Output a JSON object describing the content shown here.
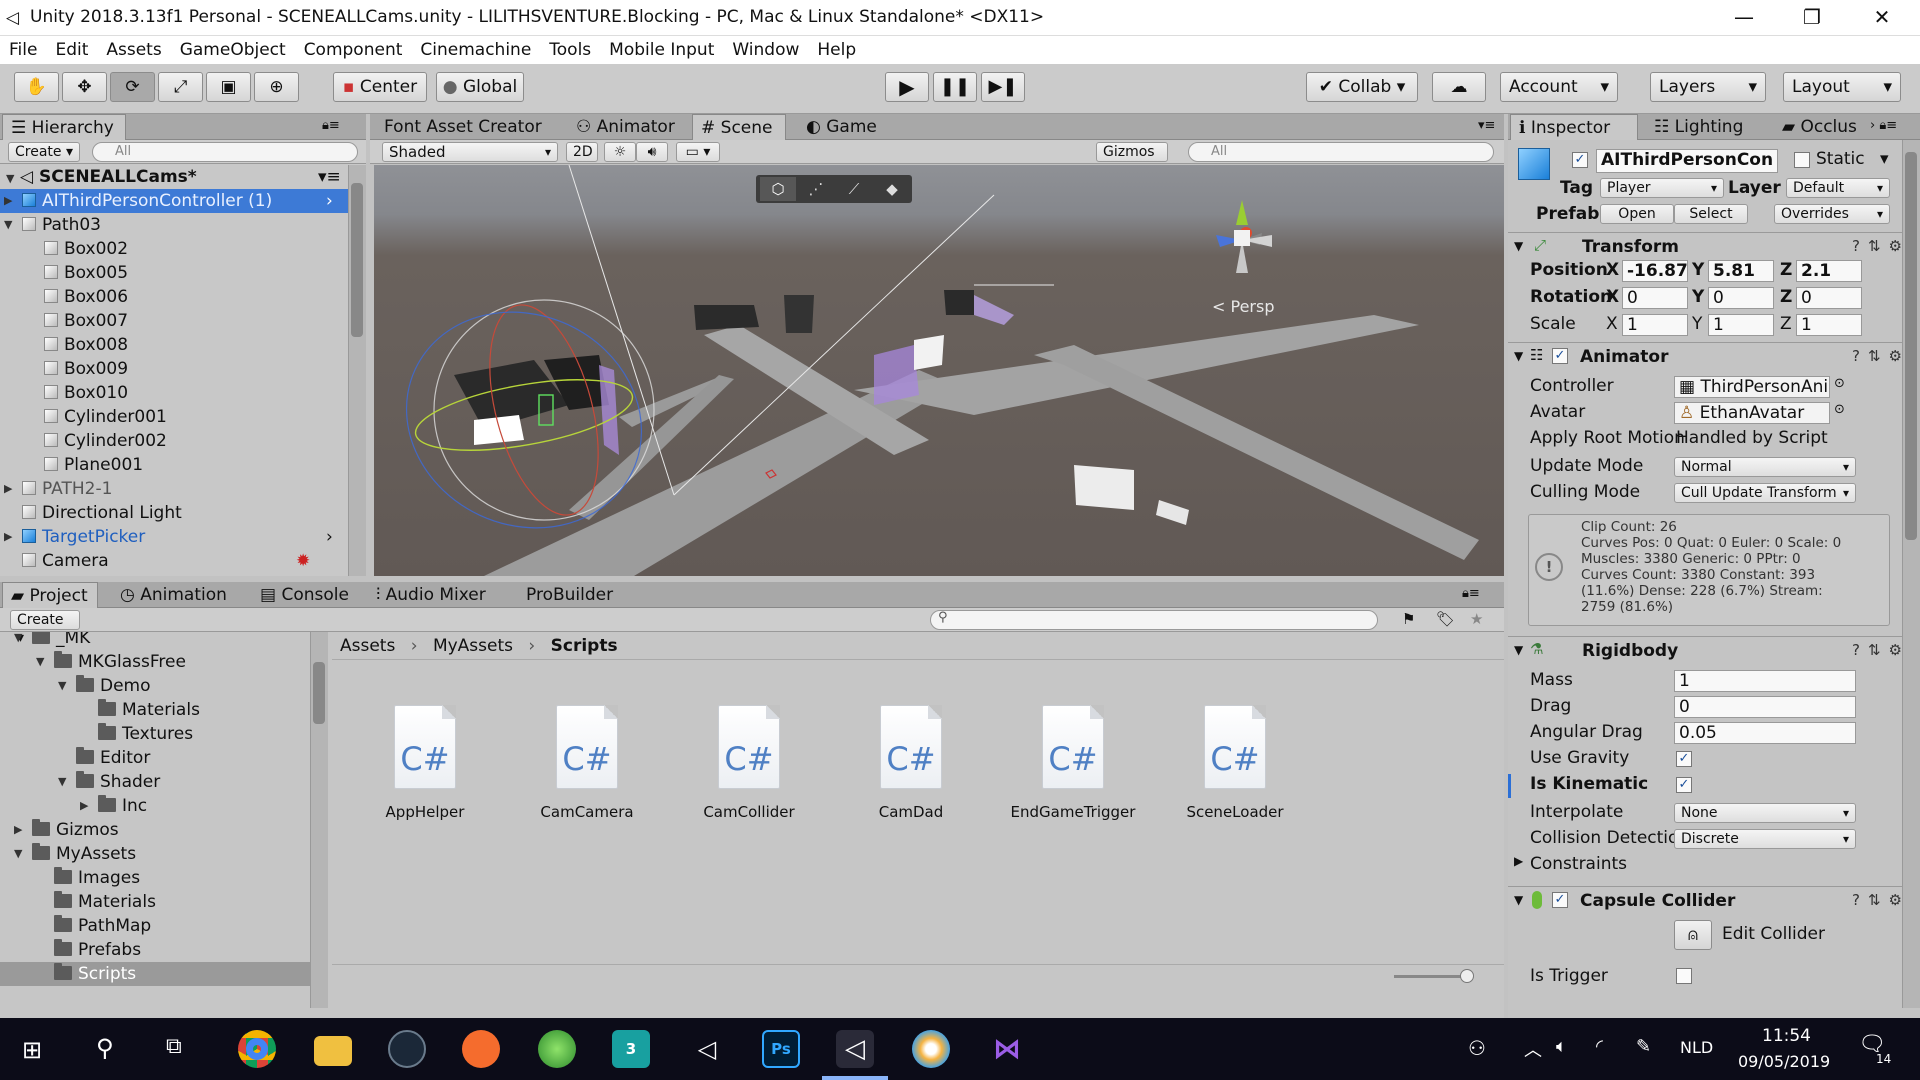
{
  "window": {
    "title": "Unity 2018.3.13f1 Personal - SCENEALLCams.unity - LILITHSVENTURE.Blocking - PC, Mac & Linux Standalone* <DX11>",
    "controls": [
      "—",
      "❐",
      "✕"
    ]
  },
  "menu": [
    "File",
    "Edit",
    "Assets",
    "GameObject",
    "Component",
    "Cinemachine",
    "Tools",
    "Mobile Input",
    "Window",
    "Help"
  ],
  "toolbar": {
    "pivot": "Center",
    "space": "Global",
    "collab": "Collab",
    "account": "Account",
    "layers": "Layers",
    "layout": "Layout"
  },
  "hierarchy": {
    "tab": "Hierarchy",
    "create": "Create",
    "search_placeholder": "All",
    "scene": "SCENEALLCams*",
    "items": [
      {
        "label": "AIThirdPersonController (1)",
        "level": 1,
        "prefab": true,
        "selected": true,
        "arrow": "▶"
      },
      {
        "label": "Path03",
        "level": 1,
        "prefab": false,
        "arrow": "▼"
      },
      {
        "label": "Box002",
        "level": 2,
        "prefab": false,
        "arrow": ""
      },
      {
        "label": "Box005",
        "level": 2,
        "prefab": false,
        "arrow": ""
      },
      {
        "label": "Box006",
        "level": 2,
        "prefab": false,
        "arrow": ""
      },
      {
        "label": "Box007",
        "level": 2,
        "prefab": false,
        "arrow": ""
      },
      {
        "label": "Box008",
        "level": 2,
        "prefab": false,
        "arrow": ""
      },
      {
        "label": "Box009",
        "level": 2,
        "prefab": false,
        "arrow": ""
      },
      {
        "label": "Box010",
        "level": 2,
        "prefab": false,
        "arrow": ""
      },
      {
        "label": "Cylinder001",
        "level": 2,
        "prefab": false,
        "arrow": ""
      },
      {
        "label": "Cylinder002",
        "level": 2,
        "prefab": false,
        "arrow": ""
      },
      {
        "label": "Plane001",
        "level": 2,
        "prefab": false,
        "arrow": ""
      },
      {
        "label": "PATH2-1",
        "level": 1,
        "prefab": false,
        "arrow": "▶",
        "dim": true
      },
      {
        "label": "Directional Light",
        "level": 1,
        "prefab": false,
        "arrow": ""
      },
      {
        "label": "TargetPicker",
        "level": 1,
        "prefab": true,
        "arrow": "▶"
      },
      {
        "label": "Camera",
        "level": 1,
        "prefab": false,
        "arrow": ""
      }
    ]
  },
  "scene_tabs": [
    "Font Asset Creator",
    "Animator",
    "Scene",
    "Game"
  ],
  "scene_bar": {
    "shading": "Shaded",
    "mode2d": "2D",
    "gizmos": "Gizmos",
    "search_placeholder": "All"
  },
  "scene_view": {
    "persp_label": "< Persp"
  },
  "project_tabs": [
    "Project",
    "Animation",
    "Console",
    "Audio Mixer",
    "ProBuilder"
  ],
  "project": {
    "create": "Create",
    "tree": [
      {
        "label": "_MK",
        "level": 1,
        "arrow": "▼"
      },
      {
        "label": "MKGlassFree",
        "level": 2,
        "arrow": "▼"
      },
      {
        "label": "Demo",
        "level": 3,
        "arrow": "▼"
      },
      {
        "label": "Materials",
        "level": 4,
        "arrow": ""
      },
      {
        "label": "Textures",
        "level": 4,
        "arrow": ""
      },
      {
        "label": "Editor",
        "level": 3,
        "arrow": ""
      },
      {
        "label": "Shader",
        "level": 3,
        "arrow": "▼"
      },
      {
        "label": "Inc",
        "level": 4,
        "arrow": "▶"
      },
      {
        "label": "Gizmos",
        "level": 1,
        "arrow": "▶"
      },
      {
        "label": "MyAssets",
        "level": 1,
        "arrow": "▼"
      },
      {
        "label": "Images",
        "level": 2,
        "arrow": ""
      },
      {
        "label": "Materials",
        "level": 2,
        "arrow": ""
      },
      {
        "label": "PathMap",
        "level": 2,
        "arrow": ""
      },
      {
        "label": "Prefabs",
        "level": 2,
        "arrow": ""
      },
      {
        "label": "Scripts",
        "level": 2,
        "arrow": "",
        "selected": true
      }
    ],
    "breadcrumb": [
      "Assets",
      "MyAssets",
      "Scripts"
    ],
    "assets": [
      "AppHelper",
      "CamCamera",
      "CamCollider",
      "CamDad",
      "EndGameTrigger",
      "SceneLoader"
    ],
    "asset_glyph": "C#"
  },
  "inspector": {
    "tabs": [
      "Inspector",
      "Lighting",
      "Occlus"
    ],
    "name": "AIThirdPersonCon",
    "static_label": "Static",
    "tag_label": "Tag",
    "tag": "Player",
    "layer_label": "Layer",
    "layer": "Default",
    "prefab_label": "Prefab",
    "open": "Open",
    "select": "Select",
    "overrides": "Overrides",
    "transform": {
      "title": "Transform",
      "rows": [
        {
          "label": "Position",
          "x": "-16.87",
          "y": "5.81",
          "z": "2.1"
        },
        {
          "label": "Rotation",
          "x": "0",
          "y": "0",
          "z": "0"
        },
        {
          "label": "Scale",
          "x": "1",
          "y": "1",
          "z": "1"
        }
      ]
    },
    "animator": {
      "title": "Animator",
      "controller_label": "Controller",
      "controller": "ThirdPersonAni",
      "avatar_label": "Avatar",
      "avatar": "EthanAvatar",
      "root_motion_label": "Apply Root Motion",
      "root_motion": "Handled by Script",
      "update_label": "Update Mode",
      "update": "Normal",
      "culling_label": "Culling Mode",
      "culling": "Cull Update Transform",
      "info_lines": [
        "Clip Count: 26",
        "Curves Pos: 0 Quat: 0 Euler: 0 Scale: 0",
        "Muscles: 3380 Generic: 0 PPtr: 0",
        "Curves Count: 3380 Constant: 393",
        "(11.6%) Dense: 228 (6.7%) Stream:",
        "2759 (81.6%)"
      ]
    },
    "rigidbody": {
      "title": "Rigidbody",
      "mass_label": "Mass",
      "mass": "1",
      "drag_label": "Drag",
      "drag": "0",
      "angular_label": "Angular Drag",
      "angular": "0.05",
      "gravity_label": "Use Gravity",
      "kinematic_label": "Is Kinematic",
      "interpolate_label": "Interpolate",
      "interpolate": "None",
      "collision_label": "Collision Detection",
      "collision": "Discrete",
      "constraints_label": "Constraints"
    },
    "capsule": {
      "title": "Capsule Collider",
      "edit_label": "Edit Collider",
      "trigger_label": "Is Trigger"
    }
  },
  "taskbar": {
    "language": "NLD",
    "time": "11:54",
    "date": "09/05/2019",
    "notifications": "14"
  }
}
